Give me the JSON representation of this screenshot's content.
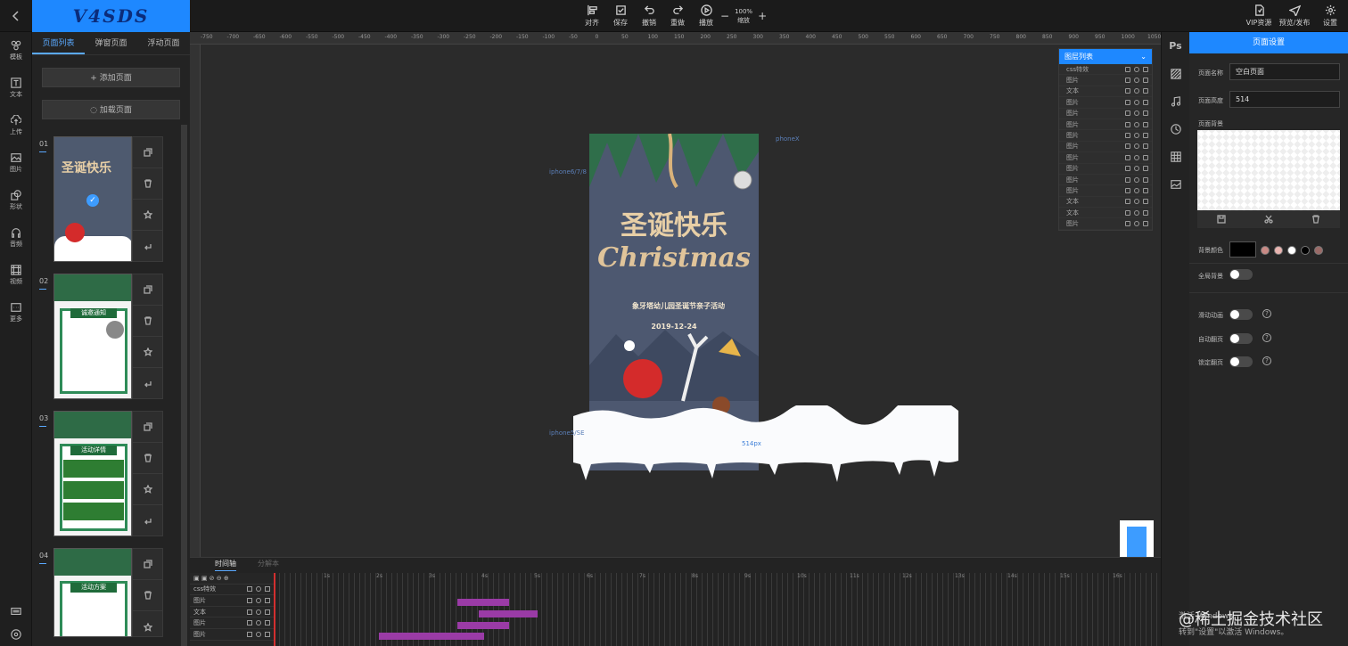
{
  "topbar": {
    "back_icon": "chevron-left-icon",
    "logo_text": "V4SDS",
    "tools": [
      {
        "label": "对齐",
        "icon": "align-icon"
      },
      {
        "label": "保存",
        "icon": "save-icon"
      },
      {
        "label": "撤销",
        "icon": "undo-icon"
      },
      {
        "label": "重做",
        "icon": "redo-icon"
      },
      {
        "label": "播放",
        "icon": "play-icon"
      }
    ],
    "zoom": {
      "minus": "−",
      "value": "100%",
      "label": "缩放",
      "plus": "+"
    },
    "right_tools": [
      {
        "label": "VIP资源",
        "icon": "vip-icon"
      },
      {
        "label": "预览/发布",
        "icon": "send-icon"
      },
      {
        "label": "设置",
        "icon": "gear-icon"
      }
    ]
  },
  "left_nav": [
    {
      "label": "模板",
      "icon": "template-icon"
    },
    {
      "label": "文本",
      "icon": "text-icon"
    },
    {
      "label": "上传",
      "icon": "upload-icon"
    },
    {
      "label": "图片",
      "icon": "image-icon"
    },
    {
      "label": "形状",
      "icon": "shape-icon"
    },
    {
      "label": "音频",
      "icon": "headphones-icon"
    },
    {
      "label": "视频",
      "icon": "video-icon"
    },
    {
      "label": "更多",
      "icon": "more-icon"
    }
  ],
  "pages_panel": {
    "tabs": [
      "页面列表",
      "弹窗页面",
      "浮动页面"
    ],
    "add_page": "添加页面",
    "load_page": "加载页面",
    "pages": [
      {
        "num": "01",
        "title": "圣诞快乐"
      },
      {
        "num": "02",
        "title": "诚邀通知"
      },
      {
        "num": "03",
        "title": "活动详情"
      },
      {
        "num": "04",
        "title": "活动方案"
      }
    ]
  },
  "canvas": {
    "guide_top": "phoneX",
    "guide_left": "iphone6/7/8",
    "guide_mid": "iphone5/SE",
    "size_label": "514px",
    "poster": {
      "title_cn": "圣诞快乐",
      "title_en": "Christmas",
      "subtitle": "象牙塔幼儿园圣诞节亲子活动",
      "date": "2019-12-24"
    }
  },
  "ruler_ticks": [
    "-750",
    "-700",
    "-650",
    "-600",
    "-550",
    "-500",
    "-450",
    "-400",
    "-350",
    "-300",
    "-250",
    "-200",
    "-150",
    "-100",
    "-50",
    "0",
    "50",
    "100",
    "150",
    "200",
    "250",
    "300",
    "350",
    "400",
    "450",
    "500",
    "550",
    "600",
    "650",
    "700",
    "750",
    "800",
    "850",
    "900",
    "950",
    "1000",
    "1050",
    "1100",
    "1150",
    "1200"
  ],
  "layers": {
    "title": "图层列表",
    "items": [
      "css特效",
      "图片",
      "文本",
      "图片",
      "图片",
      "图片",
      "图片",
      "图片",
      "图片",
      "图片",
      "图片",
      "图片",
      "文本",
      "文本",
      "图片"
    ]
  },
  "right_icons": [
    {
      "label": "Ps",
      "icon": "ps-icon"
    },
    {
      "label": "",
      "icon": "texture-icon"
    },
    {
      "label": "",
      "icon": "music-icon"
    },
    {
      "label": "",
      "icon": "history-icon"
    },
    {
      "label": "",
      "icon": "grid-icon"
    },
    {
      "label": "",
      "icon": "picture-icon"
    }
  ],
  "settings": {
    "title": "页面设置",
    "name_label": "页面名称",
    "name_value": "空白页面",
    "height_label": "页面高度",
    "height_value": "514",
    "bg_label": "页面背景",
    "color_label": "背景颜色",
    "colors": [
      "#000000",
      "#c98a85",
      "#e8b4b0",
      "#ffffff",
      "#000000",
      "#9a6b68"
    ],
    "full_bg_label": "全局背景",
    "slide_anim_label": "滑动动画",
    "auto_flip_label": "自动翻页",
    "lock_flip_label": "锁定翻页",
    "help": "?"
  },
  "timeline": {
    "tab_active": "时间轴",
    "tab_inactive": "分解本",
    "rows": [
      "css特效",
      "图片",
      "文本",
      "图片",
      "图片"
    ],
    "scale": [
      "1s",
      "2s",
      "3s",
      "4s",
      "5s",
      "6s",
      "7s",
      "8s",
      "9s",
      "10s",
      "11s",
      "12s",
      "13s",
      "14s",
      "15s",
      "16s"
    ]
  },
  "watermark": "@稀土掘金技术社区",
  "win_notice": [
    "激活 Windows",
    "转到\"设置\"以激活 Windows。"
  ]
}
